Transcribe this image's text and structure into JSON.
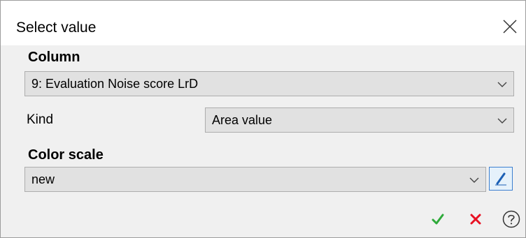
{
  "dialog": {
    "title": "Select value",
    "close_icon": "close-icon"
  },
  "column": {
    "label": "Column",
    "selected": "9: Evaluation Noise score LrD"
  },
  "kind": {
    "label": "Kind",
    "selected": "Area value"
  },
  "color_scale": {
    "label": "Color scale",
    "selected": "new",
    "edit_icon": "pencil-icon"
  },
  "actions": {
    "ok_icon": "checkmark-icon",
    "ok_color": "#2eaa3a",
    "cancel_icon": "x-icon",
    "cancel_color": "#e81123",
    "help_icon": "question-circle-icon"
  }
}
